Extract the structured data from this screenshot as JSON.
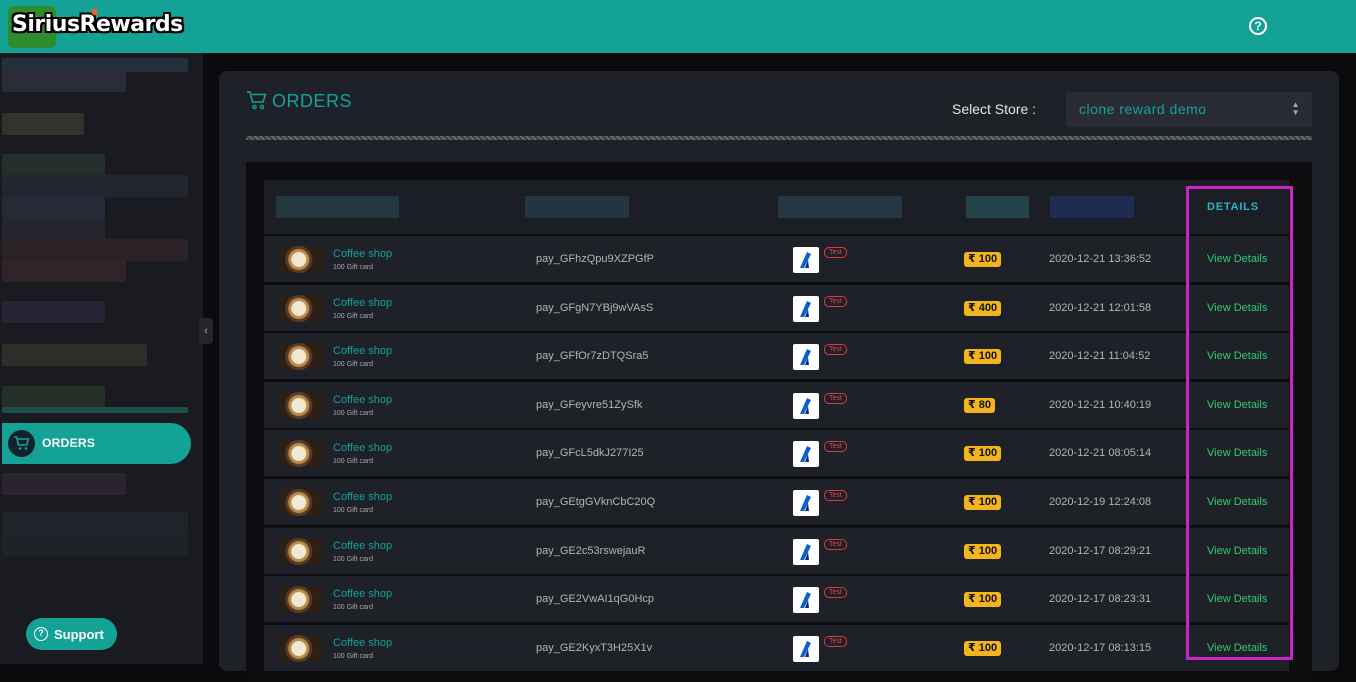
{
  "brand": {
    "name": "SiriusRewards",
    "accent": "#14a296"
  },
  "header": {
    "help_icon": "help-circle-icon"
  },
  "sidebar": {
    "active_item": "ORDERS",
    "support_label": "Support"
  },
  "orders": {
    "title": "ORDERS",
    "store_label": "Select Store :",
    "store_value": "clone reward demo",
    "columns": {
      "details": "DETAILS"
    },
    "rows": [
      {
        "name": "Coffee shop",
        "sub": "100 Gift card",
        "pay_id": "pay_GFhzQpu9XZPGfP",
        "badge": "Test",
        "amount": "₹ 100",
        "date": "2020-12-21 13:36:52",
        "action": "View Details"
      },
      {
        "name": "Coffee shop",
        "sub": "100 Gift card",
        "pay_id": "pay_GFgN7YBj9wVAsS",
        "badge": "Test",
        "amount": "₹ 400",
        "date": "2020-12-21 12:01:58",
        "action": "View Details"
      },
      {
        "name": "Coffee shop",
        "sub": "100 Gift card",
        "pay_id": "pay_GFfOr7zDTQSra5",
        "badge": "Test",
        "amount": "₹ 100",
        "date": "2020-12-21 11:04:52",
        "action": "View Details"
      },
      {
        "name": "Coffee shop",
        "sub": "100 Gift card",
        "pay_id": "pay_GFeyvre51ZySfk",
        "badge": "Test",
        "amount": "₹ 80",
        "date": "2020-12-21 10:40:19",
        "action": "View Details"
      },
      {
        "name": "Coffee shop",
        "sub": "100 Gift card",
        "pay_id": "pay_GFcL5dkJ277I25",
        "badge": "Test",
        "amount": "₹ 100",
        "date": "2020-12-21 08:05:14",
        "action": "View Details"
      },
      {
        "name": "Coffee shop",
        "sub": "100 Gift card",
        "pay_id": "pay_GEtgGVknCbC20Q",
        "badge": "Test",
        "amount": "₹ 100",
        "date": "2020-12-19 12:24:08",
        "action": "View Details"
      },
      {
        "name": "Coffee shop",
        "sub": "100 Gift card",
        "pay_id": "pay_GE2c53rswejauR",
        "badge": "Test",
        "amount": "₹ 100",
        "date": "2020-12-17 08:29:21",
        "action": "View Details"
      },
      {
        "name": "Coffee shop",
        "sub": "100 Gift card",
        "pay_id": "pay_GE2VwAI1qG0Hcp",
        "badge": "Test",
        "amount": "₹ 100",
        "date": "2020-12-17 08:23:31",
        "action": "View Details"
      },
      {
        "name": "Coffee shop",
        "sub": "100 Gift card",
        "pay_id": "pay_GE2KyxT3H25X1v",
        "badge": "Test",
        "amount": "₹ 100",
        "date": "2020-12-17 08:13:15",
        "action": "View Details"
      }
    ]
  }
}
